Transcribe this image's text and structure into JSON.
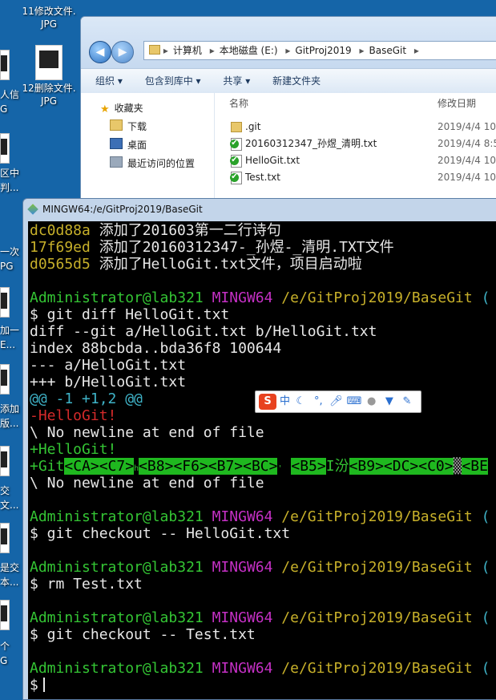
{
  "desktop": {
    "icons": [
      {
        "label": "11修改文件.\nJPG"
      },
      {
        "label": "12删除文件.\nJPG"
      }
    ],
    "edge_labels": [
      "人信",
      "G",
      "区中",
      "判...",
      "一次",
      "PG",
      "加一",
      "E...",
      "添加",
      "版...",
      "交",
      "文...",
      "是交",
      "本...",
      "个",
      "G"
    ]
  },
  "explorer": {
    "address": [
      "计算机",
      "本地磁盘 (E:)",
      "GitProj2019",
      "BaseGit"
    ],
    "back_icon": "back-arrow-icon",
    "forward_icon": "forward-arrow-icon",
    "toolbar": [
      "组织",
      "包含到库中",
      "共享",
      "新建文件夹"
    ],
    "nav": {
      "favorites": "收藏夹",
      "items": [
        "下载",
        "桌面",
        "最近访问的位置"
      ]
    },
    "columns": {
      "name": "名称",
      "date": "修改日期"
    },
    "files": [
      {
        "name": ".git",
        "date": "2019/4/4 10:",
        "type": "folder"
      },
      {
        "name": "20160312347_孙煜_清明.txt",
        "date": "2019/4/4 8:5",
        "type": "txt"
      },
      {
        "name": "HelloGit.txt",
        "date": "2019/4/4 10:",
        "type": "txt"
      },
      {
        "name": "Test.txt",
        "date": "2019/4/4 10:",
        "type": "txt"
      }
    ]
  },
  "terminal": {
    "title": "MINGW64:/e/GitProj2019/BaseGit",
    "log": [
      {
        "hash": "dc0d88a",
        "msg": "添加了201603第一二行诗句"
      },
      {
        "hash": "17f69ed",
        "msg": "添加了20160312347-_孙煜-_清明.TXT文件"
      },
      {
        "hash": "d0565d5",
        "msg": "添加了HelloGit.txt文件，项目启动啦"
      }
    ],
    "prompt": {
      "user": "Administrator@lab321",
      "shell": "MINGW64",
      "path": "/e/GitProj2019/BaseGit",
      "tail": "("
    },
    "cmd1": "$ git diff HelloGit.txt",
    "diff": [
      "diff --git a/HelloGit.txt b/HelloGit.txt",
      "index 88bcbda..bda36f8 100644",
      "--- a/HelloGit.txt",
      "+++ b/HelloGit.txt"
    ],
    "hunk": "@@ -1 +1,2 @@",
    "removed": "-HelloGit!",
    "no_newline": "\\ No newline at end of file",
    "added1": "+HelloGit!",
    "added2_prefix": "+Git",
    "added2_bytes": [
      "<CA><C7>",
      "h",
      "<B8><F6><B7><BC>",
      "'",
      "<B5>",
      "I汾",
      "<B9><DC><C0>",
      "▒",
      "<BE"
    ],
    "no_newline2": "\\ No newline at end of file",
    "cmd2": "$ git checkout -- HelloGit.txt",
    "cmd3": "$ rm Test.txt",
    "cmd4": "$ git checkout -- Test.txt",
    "cmd5": "$"
  },
  "ime": {
    "label": "中",
    "icons": [
      "moon-icon",
      "punctuation-icon",
      "microphone-icon",
      "keyboard-icon",
      "user-icon",
      "shirt-icon",
      "wrench-icon"
    ]
  }
}
